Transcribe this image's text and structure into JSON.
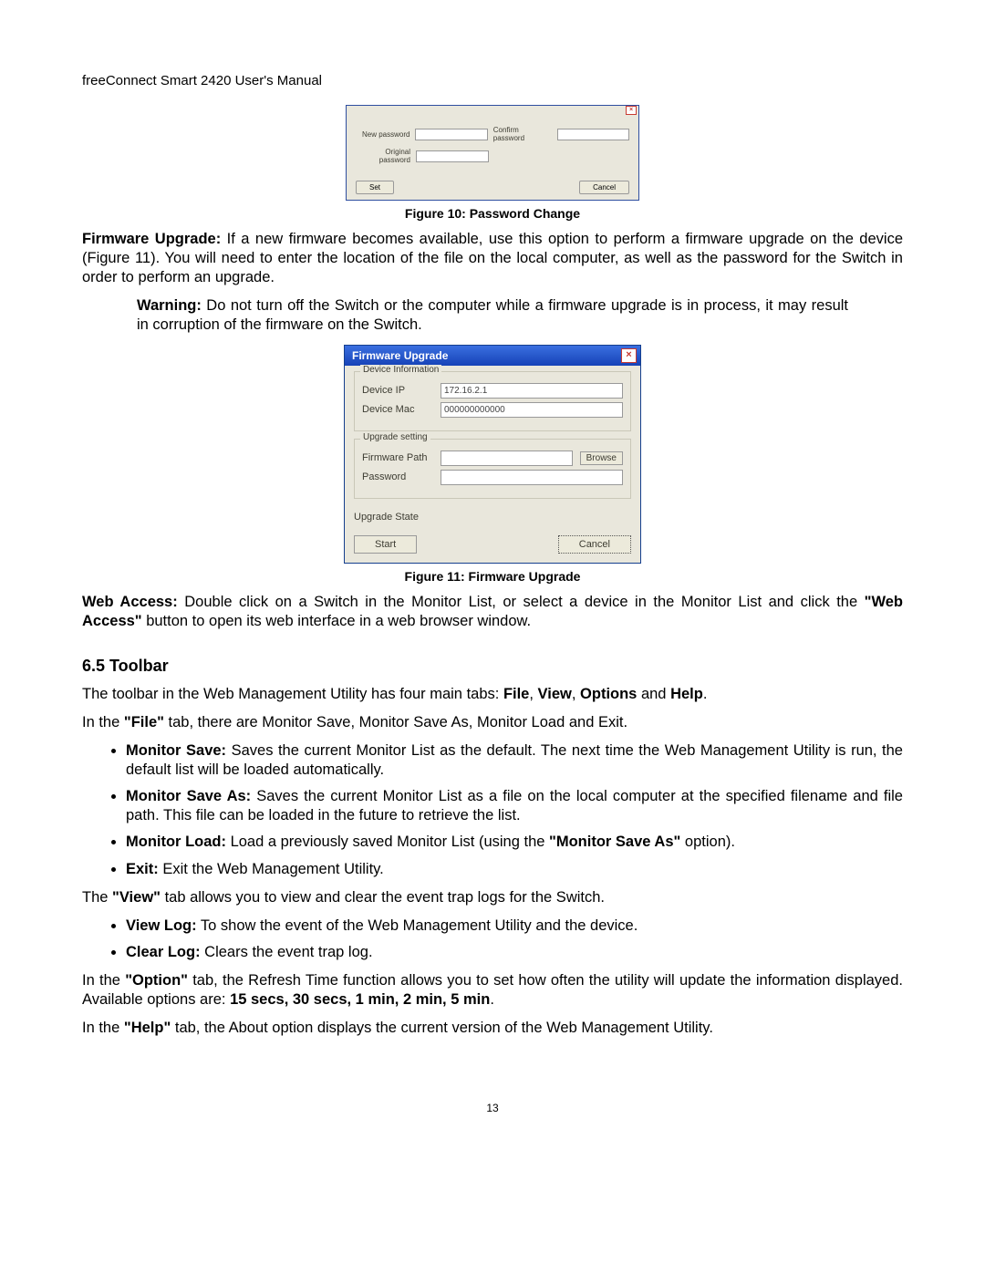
{
  "header": {
    "title": "freeConnect Smart 2420 User's Manual"
  },
  "fig10": {
    "dialog": {
      "new_password_label": "New password",
      "confirm_password_label": "Confirm password",
      "original_password_label": "Original password",
      "set_btn": "Set",
      "cancel_btn": "Cancel"
    },
    "caption": "Figure 10: Password Change"
  },
  "para_firmware_bold": "Firmware Upgrade:",
  "para_firmware_rest": " If a new firmware becomes available, use this option to perform a firmware upgrade on the device (Figure 11).  You will need to enter the location of the file on the local computer, as well as the password for the Switch in order to perform an upgrade.",
  "warning_bold": "Warning:",
  "warning_rest": " Do not turn off the Switch or the computer while a firmware upgrade is in process, it may result in corruption of the firmware on the Switch.",
  "fig11": {
    "title": "Firmware Upgrade",
    "device_info_legend": "Device Information",
    "device_ip_label": "Device IP",
    "device_ip_value": "172.16.2.1",
    "device_mac_label": "Device Mac",
    "device_mac_value": "000000000000",
    "upgrade_setting_legend": "Upgrade setting",
    "firmware_path_label": "Firmware Path",
    "browse_btn": "Browse",
    "password_label": "Password",
    "upgrade_state_label": "Upgrade State",
    "start_btn": "Start",
    "cancel_btn": "Cancel",
    "caption": "Figure 11: Firmware Upgrade"
  },
  "para_web_bold": "Web Access:",
  "para_web_rest_a": " Double click on a Switch in the Monitor List, or select a device in the Monitor List and click the ",
  "para_web_quote": "\"Web Access\"",
  "para_web_rest_b": " button to open its web interface in a web browser window.",
  "section_heading": "6.5   Toolbar",
  "toolbar_intro_a": "The toolbar in the Web Management Utility has four main tabs: ",
  "toolbar_intro_file": "File",
  "toolbar_intro_sep": ", ",
  "toolbar_intro_view": "View",
  "toolbar_intro_options": "Options",
  "toolbar_intro_and": " and ",
  "toolbar_intro_help": "Help",
  "toolbar_intro_end": ".",
  "file_para_a": "In the ",
  "file_para_q": "\"File\"",
  "file_para_b": " tab, there are Monitor Save, Monitor Save As, Monitor Load and Exit.",
  "file_items": {
    "msave_b": "Monitor Save:",
    "msave_t": " Saves the current Monitor List as the default.  The next time the Web Management Utility is run, the default list will be loaded automatically.",
    "msaveas_b": "Monitor Save As:",
    "msaveas_t": " Saves the current Monitor List as a file on the local computer at the specified filename and file path.  This file can be loaded in the future to retrieve the list.",
    "mload_b": "Monitor Load:",
    "mload_t_a": " Load a previously saved Monitor List (using the ",
    "mload_q": "\"Monitor Save As\"",
    "mload_t_b": " option).",
    "exit_b": "Exit:",
    "exit_t": " Exit the Web Management Utility."
  },
  "view_para_a": "The ",
  "view_para_q": "\"View\"",
  "view_para_b": " tab allows you to view and clear the event trap logs for the Switch.",
  "view_items": {
    "vlog_b": "View Log:",
    "vlog_t": " To show the event of the Web Management Utility and the device.",
    "clog_b": "Clear Log:",
    "clog_t": " Clears the event trap log."
  },
  "option_para_a": "In the ",
  "option_para_q": "\"Option\"",
  "option_para_b": " tab, the Refresh Time function allows you to set how often the utility will update the information displayed. Available options are: ",
  "option_para_opts": "15 secs, 30 secs, 1 min, 2 min, 5 min",
  "option_para_end": ".",
  "help_para_a": "In the ",
  "help_para_q": "\"Help\"",
  "help_para_b": " tab, the About option displays the current version of the Web Management Utility.",
  "page_number": "13"
}
